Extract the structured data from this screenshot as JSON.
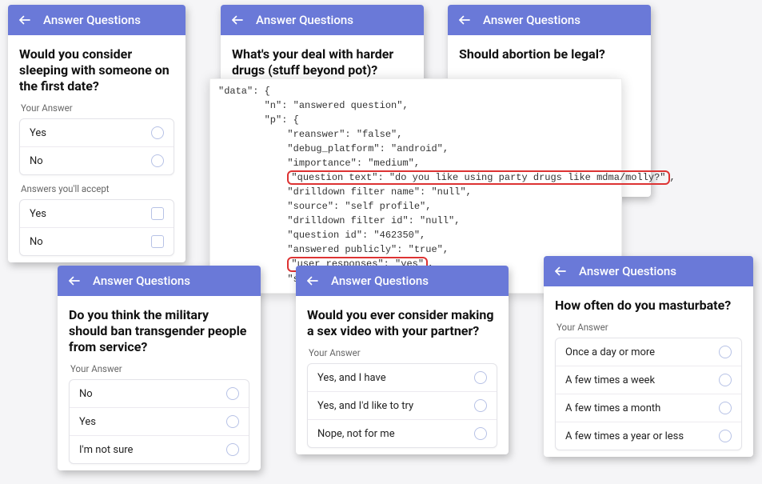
{
  "header_title": "Answer Questions",
  "labels": {
    "your_answer": "Your Answer",
    "answers_accept": "Answers you'll accept"
  },
  "q1": {
    "text": "Would you consider sleeping with someone on the first date?",
    "answers": [
      "Yes",
      "No"
    ],
    "accept": [
      "Yes",
      "No"
    ]
  },
  "q2": {
    "text": "What's your deal with harder drugs (stuff beyond pot)?"
  },
  "q3": {
    "text": "Should abortion be legal?"
  },
  "q4": {
    "text": "Do you think the military should ban transgender people from service?",
    "answers": [
      "No",
      "Yes",
      "I'm not sure"
    ]
  },
  "q5": {
    "text": "Would you ever consider making a sex video with your partner?",
    "answers": [
      "Yes, and I have",
      "Yes, and I'd like to try",
      "Nope, not for me"
    ]
  },
  "q6": {
    "text": "How often do you masturbate?",
    "answers": [
      "Once a day or more",
      "A few times a week",
      "A few times a month",
      "A few times a year or less"
    ]
  },
  "json_dump": {
    "l1": "\"data\": {",
    "l2": "        \"n\": \"answered question\",",
    "l3": "        \"p\": {",
    "l4": "            \"reanswer\": \"false\",",
    "l5": "            \"debug_platform\": \"android\",",
    "l6": "            \"importance\": \"medium\",",
    "l7a": "            ",
    "l7b": "\"question text\": \"do you like using party drugs like mdma/molly?\"",
    "l7c": ",",
    "l8": "            \"drilldown filter name\": \"null\",",
    "l9": "            \"source\": \"self profile\",",
    "l10": "            \"drilldown filter id\": \"null\",",
    "l11": "            \"question id\": \"462350\",",
    "l12": "            \"answered publicly\": \"true\",",
    "l13a": "            ",
    "l13b": "\"user responses\": \"yes\"",
    "l13c": ",",
    "l14": "            \"skipped\": \"false\""
  }
}
